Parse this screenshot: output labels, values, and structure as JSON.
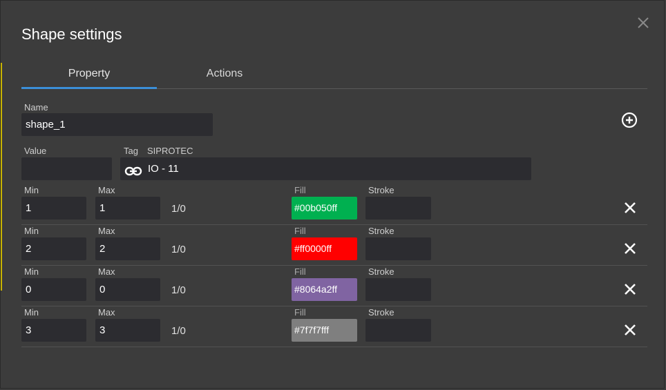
{
  "dialog": {
    "title": "Shape settings",
    "close_icon": "close-icon"
  },
  "tabs": [
    {
      "label": "Property",
      "active": true
    },
    {
      "label": "Actions",
      "active": false
    }
  ],
  "name": {
    "label": "Name",
    "value": "shape_1"
  },
  "value": {
    "label": "Value",
    "value": ""
  },
  "tag": {
    "label": "Tag",
    "source": "SIPROTEC",
    "value": "IO - 11",
    "icon": "link-icon"
  },
  "add_icon": "plus-circle-icon",
  "labels": {
    "min": "Min",
    "max": "Max",
    "fill": "Fill",
    "stroke": "Stroke"
  },
  "rules": [
    {
      "min": "1",
      "max": "1",
      "ratio": "1/0",
      "fill": "#00b050ff",
      "fill_color": "#00b050",
      "stroke": ""
    },
    {
      "min": "2",
      "max": "2",
      "ratio": "1/0",
      "fill": "#ff0000ff",
      "fill_color": "#ff0000",
      "stroke": ""
    },
    {
      "min": "0",
      "max": "0",
      "ratio": "1/0",
      "fill": "#8064a2ff",
      "fill_color": "#8064a2",
      "stroke": ""
    },
    {
      "min": "3",
      "max": "3",
      "ratio": "1/0",
      "fill": "#7f7f7fff",
      "fill_color": "#7f7f7f",
      "stroke": ""
    }
  ],
  "colors": {
    "accent": "#3b8fd9",
    "field_bg": "#2c2c30",
    "dialog_bg": "#3c3c3c"
  }
}
